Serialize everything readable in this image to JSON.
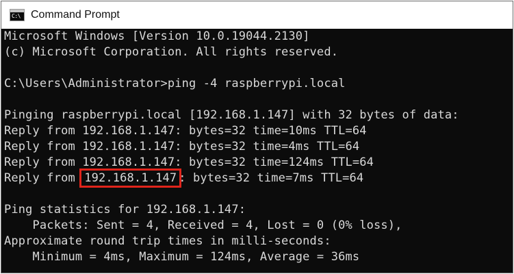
{
  "window": {
    "title": "Command Prompt",
    "icon_text": "C:\\"
  },
  "console": {
    "lines": [
      "Microsoft Windows [Version 10.0.19044.2130]",
      "(c) Microsoft Corporation. All rights reserved.",
      "",
      "C:\\Users\\Administrator>ping -4 raspberrypi.local",
      "",
      "Pinging raspberrypi.local [192.168.1.147] with 32 bytes of data:",
      "Reply from 192.168.1.147: bytes=32 time=10ms TTL=64",
      "Reply from 192.168.1.147: bytes=32 time=4ms TTL=64",
      "Reply from 192.168.1.147: bytes=32 time=124ms TTL=64"
    ],
    "highlight_line": {
      "prefix": "Reply from ",
      "highlighted": "192.168.1.147",
      "suffix": ": bytes=32 time=7ms TTL=64"
    },
    "stats_lines": [
      "",
      "Ping statistics for 192.168.1.147:",
      "    Packets: Sent = 4, Received = 4, Lost = 0 (0% loss),",
      "Approximate round trip times in milli-seconds:",
      "    Minimum = 4ms, Maximum = 124ms, Average = 36ms"
    ]
  },
  "colors": {
    "console_bg": "#0c0c0c",
    "console_text": "#d9d9d9",
    "highlight_box": "#e0241b"
  }
}
